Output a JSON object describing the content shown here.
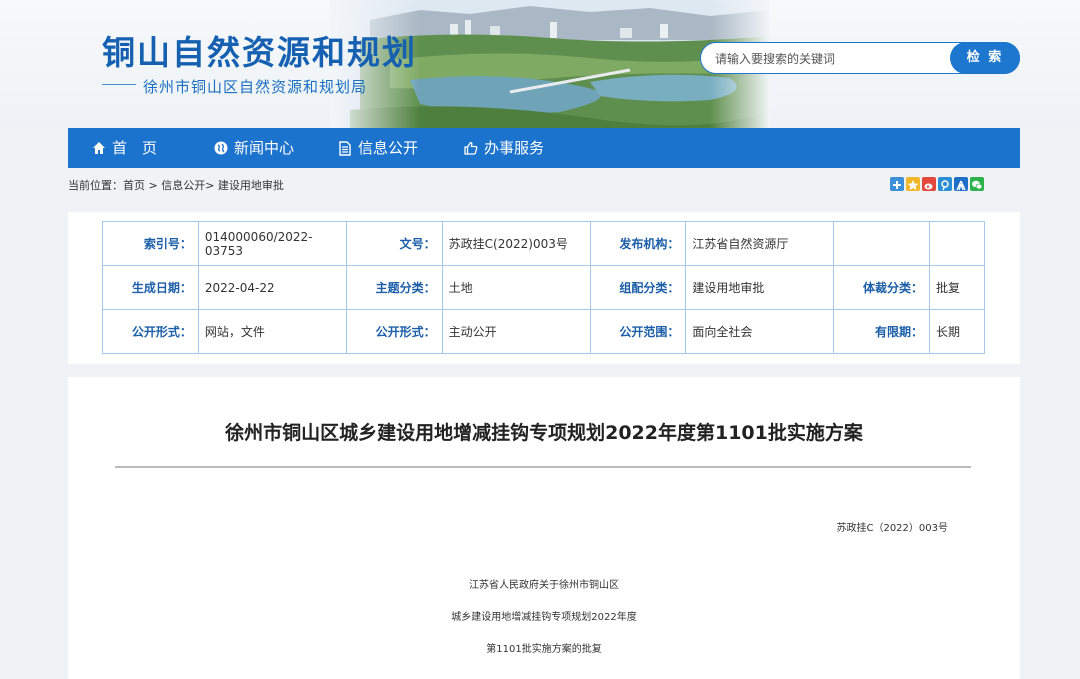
{
  "header": {
    "site_title": "铜山自然资源和规划",
    "site_subtitle": "徐州市铜山区自然资源和规划局"
  },
  "search": {
    "placeholder": "请输入要搜索的关键词",
    "button_label": "检 索"
  },
  "nav": {
    "items": [
      {
        "label": "首　页",
        "icon": "home-icon"
      },
      {
        "label": "新闻中心",
        "icon": "globe-icon"
      },
      {
        "label": "信息公开",
        "icon": "document-icon"
      },
      {
        "label": "办事服务",
        "icon": "thumbs-up-icon"
      }
    ]
  },
  "breadcrumb": {
    "text": "当前位置：首页 > 信息公开> 建设用地审批"
  },
  "share": {
    "icons": [
      "share-plus-icon",
      "qzone-icon",
      "weibo-icon",
      "tencent-weibo-icon",
      "renren-icon",
      "wechat-icon"
    ]
  },
  "meta": {
    "rows": [
      [
        {
          "label": "索引号：",
          "value": "014000060/2022-03753"
        },
        {
          "label": "文号：",
          "value": "苏政挂C(2022)003号"
        },
        {
          "label": "发布机构：",
          "value": "江苏省自然资源厅"
        },
        {
          "label": "",
          "value": ""
        }
      ],
      [
        {
          "label": "生成日期：",
          "value": "2022-04-22"
        },
        {
          "label": "主题分类：",
          "value": "土地"
        },
        {
          "label": "组配分类：",
          "value": "建设用地审批"
        },
        {
          "label": "体裁分类：",
          "value": "批复"
        }
      ],
      [
        {
          "label": "公开形式：",
          "value": "网站，文件"
        },
        {
          "label": "公开形式：",
          "value": "主动公开"
        },
        {
          "label": "公开范围：",
          "value": "面向全社会"
        },
        {
          "label": "有限期：",
          "value": "长期"
        }
      ]
    ]
  },
  "article": {
    "title": "徐州市铜山区城乡建设用地增减挂钩专项规划2022年度第1101批实施方案",
    "doc_number": "苏政挂C（2022）003号",
    "lines": [
      "江苏省人民政府关于徐州市铜山区",
      "城乡建设用地增减挂钩专项规划2022年度",
      "第1101批实施方案的批复"
    ]
  },
  "colors": {
    "brand_blue": "#1c73cd",
    "label_blue": "#1c5fa8"
  }
}
